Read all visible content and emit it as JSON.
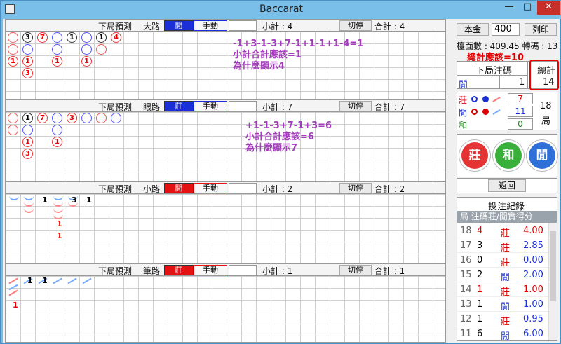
{
  "window": {
    "title": "Baccarat",
    "min": "—",
    "max": "□",
    "close": "✕"
  },
  "panels": [
    {
      "predict": "下局預測",
      "name": "大路",
      "pred_label": "閒",
      "pred_color": "blue",
      "manual": "手動",
      "sub": "小計 : 4",
      "stop": "切停",
      "total": "合計 : 4"
    },
    {
      "predict": "下局預測",
      "name": "眼路",
      "pred_label": "莊",
      "pred_color": "blue",
      "manual": "手動",
      "sub": "小計 : 7",
      "stop": "切停",
      "total": "合計 : 7"
    },
    {
      "predict": "下局預測",
      "name": "小路",
      "pred_label": "閒",
      "pred_color": "red",
      "manual": "手動",
      "sub": "小計 : 2",
      "stop": "切停",
      "total": "合計 : 2"
    },
    {
      "predict": "下局預測",
      "name": "筆路",
      "pred_label": "莊",
      "pred_color": "red",
      "manual": "手動",
      "sub": "小計 : 1",
      "stop": "切停",
      "total": "合計 : 1"
    }
  ],
  "annotations": {
    "a1": "-1+3-1-3+7-1+1-1+1-4=1",
    "a2": "小計合計應該=1",
    "a3": "為什麼顯示4",
    "b1": "+1-1-3+7-1+3=6",
    "b2": "小計合計應該=6",
    "b3": "為什麼顯示7",
    "c1": "總計應該=10"
  },
  "right": {
    "capital_label": "本金",
    "capital_value": "400",
    "print_btn": "列印",
    "stats": "檯面數 : 409.45 轉碼 : 13",
    "next_bet_label": "下局注碼",
    "grand_total_label": "總計",
    "next_bet_side": "閒",
    "next_bet_amount": "1",
    "grand_total_value": "14",
    "banker_label": "莊",
    "player_label": "閒",
    "tie_label": "和",
    "banker_count": "7",
    "player_count": "11",
    "tie_count": "0",
    "rounds_num": "18",
    "rounds_unit": "局",
    "btn_banker": "莊",
    "btn_tie": "和",
    "btn_player": "閒",
    "back_btn": "返回",
    "record_title": "投注紀錄",
    "record_header": "局  注碼莊/閒實得分",
    "records": [
      {
        "round": "18",
        "bet": "4",
        "side": "莊",
        "score": "4.00",
        "bet_color": "#e00000",
        "side_color": "#e00000",
        "score_color": "#e00000"
      },
      {
        "round": "17",
        "bet": "3",
        "side": "莊",
        "score": "2.85",
        "bet_color": "#000",
        "side_color": "#e00000",
        "score_color": "#1a2fd8"
      },
      {
        "round": "16",
        "bet": "0",
        "side": "莊",
        "score": "0.00",
        "bet_color": "#000",
        "side_color": "#e00000",
        "score_color": "#1a2fd8"
      },
      {
        "round": "15",
        "bet": "2",
        "side": "閒",
        "score": "2.00",
        "bet_color": "#000",
        "side_color": "#1a2fd8",
        "score_color": "#1a2fd8"
      },
      {
        "round": "14",
        "bet": "1",
        "side": "莊",
        "score": "1.00",
        "bet_color": "#e00000",
        "side_color": "#e00000",
        "score_color": "#e00000"
      },
      {
        "round": "13",
        "bet": "1",
        "side": "閒",
        "score": "1.00",
        "bet_color": "#000",
        "side_color": "#1a2fd8",
        "score_color": "#1a2fd8"
      },
      {
        "round": "12",
        "bet": "1",
        "side": "莊",
        "score": "0.95",
        "bet_color": "#000",
        "side_color": "#e00000",
        "score_color": "#1a2fd8"
      },
      {
        "round": "11",
        "bet": "6",
        "side": "閒",
        "score": "6.00",
        "bet_color": "#000",
        "side_color": "#1a2fd8",
        "score_color": "#1a2fd8"
      }
    ]
  },
  "big_road": {
    "n1": "3",
    "n2": "7",
    "n3": "1",
    "n4": "1",
    "n5": "4",
    "n6": "1",
    "n7": "1",
    "n8": "1",
    "n9": "1",
    "n10": "3"
  },
  "eye_road": {
    "n1": "1",
    "n2": "7",
    "n3": "3",
    "n4": "1",
    "n5": "1",
    "n6": "3"
  },
  "small_road": {
    "n1": "1",
    "n2": "3",
    "n3": "1",
    "n4": "1",
    "n5": "1"
  },
  "pen_road": {
    "n1": "1",
    "n2": "1",
    "n3": "1"
  }
}
